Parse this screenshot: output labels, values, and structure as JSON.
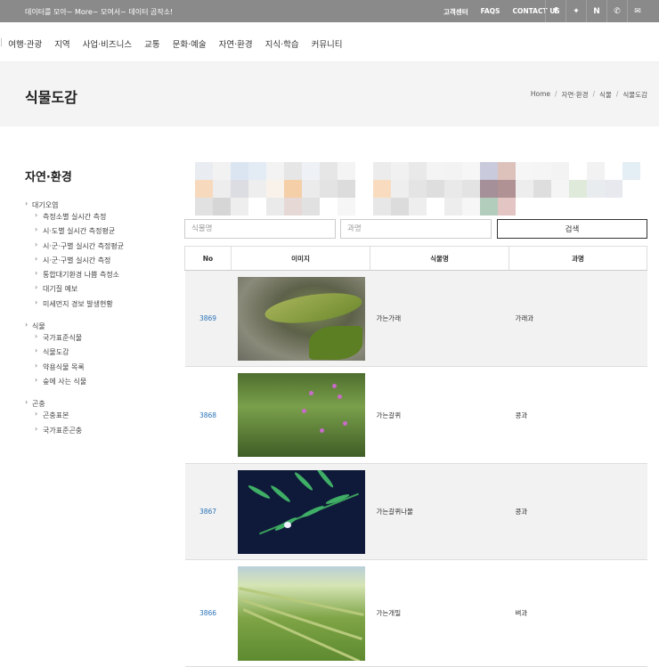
{
  "topbar": {
    "tagline": "데이터를 모아~ More~ 모여서~ 데이터 곰작소!",
    "links": [
      "고객센터",
      "FAQS",
      "CONTACT US"
    ],
    "icons": [
      "facebook-icon",
      "twitter-icon",
      "naver-icon",
      "phone-icon",
      "mail-icon"
    ],
    "icon_glyphs": [
      "f",
      "✦",
      "N",
      "✆",
      "✉"
    ]
  },
  "nav": {
    "items": [
      "여행·관광",
      "지역",
      "사업·비즈니스",
      "교통",
      "문화·예술",
      "자연·환경",
      "지식·학습",
      "커뮤니티"
    ]
  },
  "page": {
    "title": "식물도감",
    "breadcrumb": [
      "Home",
      "자연·환경",
      "식물",
      "식물도감"
    ]
  },
  "sidebar": {
    "heading": "자연·환경",
    "groups": [
      {
        "label": "대기오염",
        "items": [
          "측정소별 실시간 측정",
          "시·도별 실시간 측정평균",
          "시·군·구별 실시간 측정평균",
          "시·군·구별 실시간 측정",
          "통합대기환경 나쁨 측정소",
          "대기질 예보",
          "미세먼지 경보 발생현황"
        ]
      },
      {
        "label": "식물",
        "items": [
          "국가표준식물",
          "식물도감",
          "약용식물 목록",
          "숲에 사는 식물"
        ]
      },
      {
        "label": "곤충",
        "items": [
          "곤충표본",
          "국가표준곤충"
        ]
      }
    ]
  },
  "search": {
    "plant_placeholder": "식물명",
    "family_placeholder": "과명",
    "button_label": "검색"
  },
  "table": {
    "headers": [
      "No",
      "이미지",
      "식물명",
      "과명"
    ],
    "rows": [
      {
        "no": "3869",
        "name": "가는가래",
        "family": "가래과"
      },
      {
        "no": "3868",
        "name": "가는갈퀴",
        "family": "콩과"
      },
      {
        "no": "3867",
        "name": "가는갈퀴나물",
        "family": "콩과"
      },
      {
        "no": "3866",
        "name": "가는개밀",
        "family": "벼과"
      }
    ]
  },
  "colors": {
    "topbar_bg": "#8a8a8a",
    "band_bg": "#f4f4f4",
    "link_blue": "#2a73b8"
  }
}
